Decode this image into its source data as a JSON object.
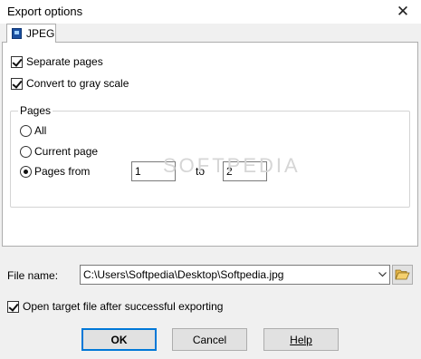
{
  "window": {
    "title": "Export options",
    "close_symbol": "✕"
  },
  "tabs": [
    {
      "label": "JPEG",
      "icon": "jpeg-file-icon",
      "active": true
    }
  ],
  "options": {
    "separate_pages": {
      "label": "Separate pages",
      "checked": true
    },
    "gray_scale": {
      "label": "Convert to gray scale",
      "checked": true
    }
  },
  "pages": {
    "legend": "Pages",
    "all_label": "All",
    "current_label": "Current page",
    "from_label": "Pages from",
    "selected": "from",
    "from_value": "1",
    "to_label": "to",
    "to_value": "2"
  },
  "watermark": "SOFTPEDIA",
  "file": {
    "label": "File name:",
    "value": "C:\\Users\\Softpedia\\Desktop\\Softpedia.jpg",
    "browse_icon": "folder-open-icon"
  },
  "open_after": {
    "label": "Open target file after successful exporting",
    "checked": true
  },
  "buttons": {
    "ok": "OK",
    "cancel": "Cancel",
    "help": "Help"
  }
}
